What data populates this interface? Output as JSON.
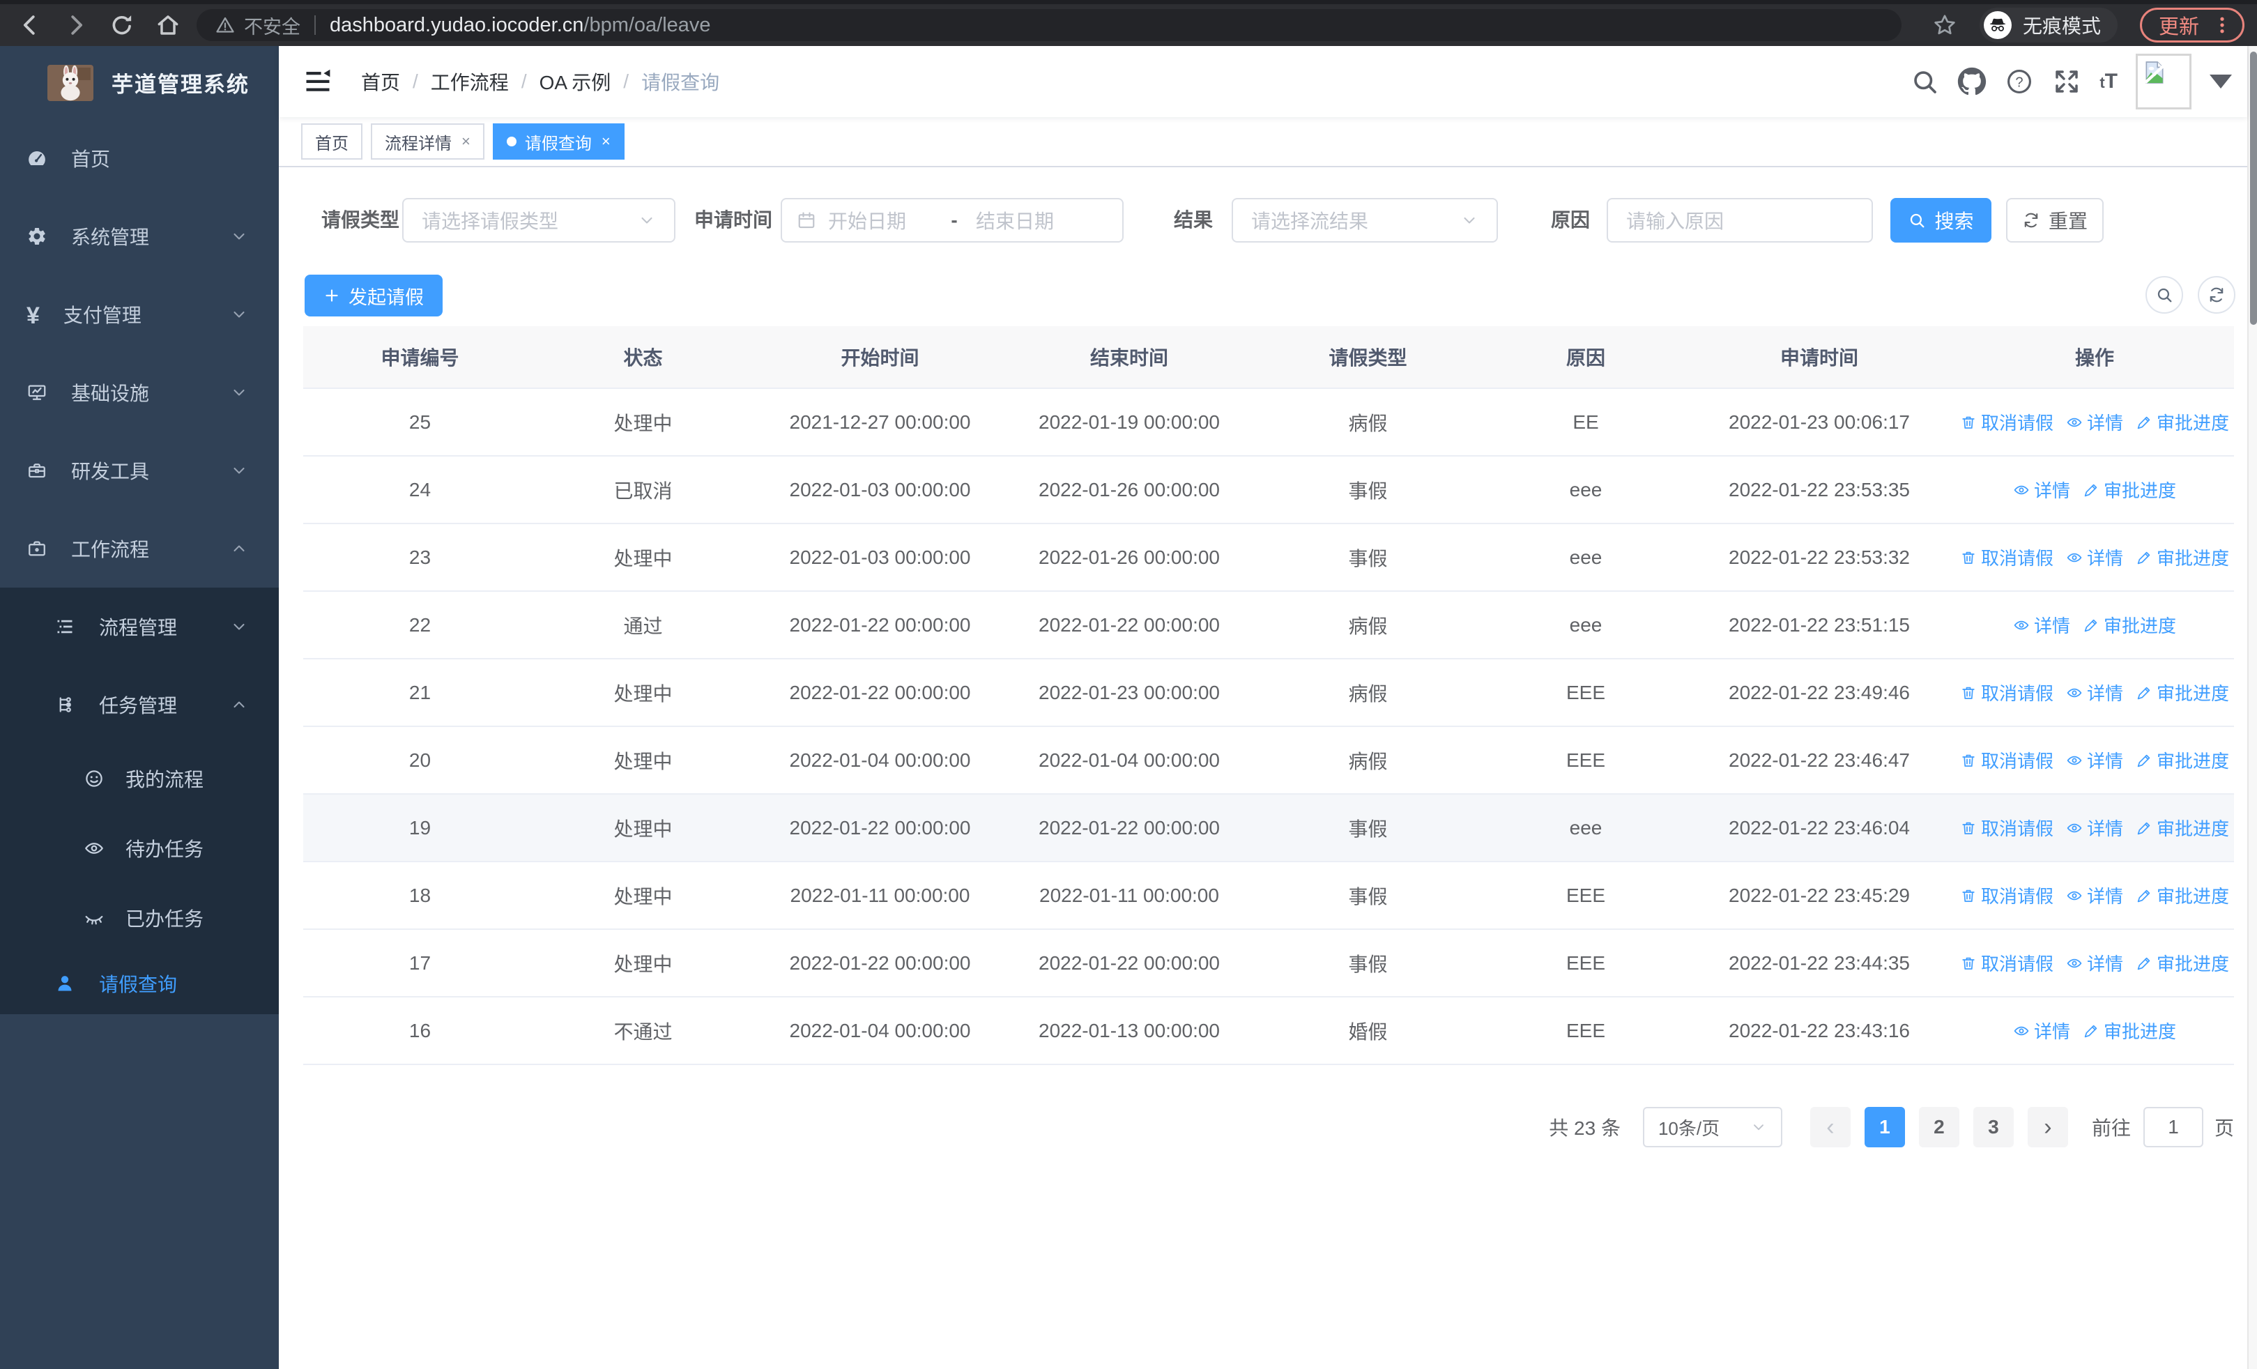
{
  "colors": {
    "accent": "#409eff",
    "sidebar_bg": "#304156",
    "submenu_bg": "#1f2d3d",
    "table_header_bg": "#f8f8f9",
    "row_hover_bg": "#f5f7fa",
    "chrome_update": "#f28b82"
  },
  "browser": {
    "security_label": "不安全",
    "url_host": "dashboard.yudao.iocoder.cn",
    "url_path": "/bpm/oa/leave",
    "incognito_label": "无痕模式",
    "update_label": "更新"
  },
  "sidebar": {
    "title": "芋道管理系统",
    "items": [
      {
        "key": "home",
        "label": "首页",
        "icon": "dashboard",
        "level": 1,
        "chevron": null,
        "sub": false,
        "active": false
      },
      {
        "key": "system",
        "label": "系统管理",
        "icon": "gear",
        "level": 1,
        "chevron": "down",
        "sub": false,
        "active": false
      },
      {
        "key": "payment",
        "label": "支付管理",
        "icon": "yen",
        "level": 1,
        "chevron": "down",
        "sub": false,
        "active": false
      },
      {
        "key": "infra",
        "label": "基础设施",
        "icon": "monitor",
        "level": 1,
        "chevron": "down",
        "sub": false,
        "active": false
      },
      {
        "key": "devtools",
        "label": "研发工具",
        "icon": "toolbox",
        "level": 1,
        "chevron": "down",
        "sub": false,
        "active": false
      },
      {
        "key": "workflow",
        "label": "工作流程",
        "icon": "briefcase",
        "level": 1,
        "chevron": "up",
        "sub": false,
        "active": false
      },
      {
        "key": "process-mgmt",
        "label": "流程管理",
        "icon": "list",
        "level": 2,
        "chevron": "down",
        "sub": true,
        "active": false
      },
      {
        "key": "task-mgmt",
        "label": "任务管理",
        "icon": "org",
        "level": 2,
        "chevron": "up",
        "sub": true,
        "active": false
      },
      {
        "key": "my-process",
        "label": "我的流程",
        "icon": "face",
        "level": 3,
        "chevron": null,
        "sub": true,
        "active": false
      },
      {
        "key": "todo-tasks",
        "label": "待办任务",
        "icon": "eye",
        "level": 3,
        "chevron": null,
        "sub": true,
        "active": false
      },
      {
        "key": "done-tasks",
        "label": "已办任务",
        "icon": "eye-off",
        "level": 3,
        "chevron": null,
        "sub": true,
        "active": false
      },
      {
        "key": "leave-query",
        "label": "请假查询",
        "icon": "person",
        "level": 2,
        "chevron": null,
        "sub": true,
        "active": true
      }
    ]
  },
  "breadcrumb": {
    "items": [
      "首页",
      "工作流程",
      "OA 示例",
      "请假查询"
    ]
  },
  "tabs": [
    {
      "key": "home",
      "label": "首页",
      "closable": false,
      "active": false
    },
    {
      "key": "process-detail",
      "label": "流程详情",
      "closable": true,
      "active": false
    },
    {
      "key": "leave-query",
      "label": "请假查询",
      "closable": true,
      "active": true
    }
  ],
  "filters": {
    "type_label": "请假类型",
    "type_placeholder": "请选择请假类型",
    "time_label": "申请时间",
    "start_placeholder": "开始日期",
    "range_separator": "-",
    "end_placeholder": "结束日期",
    "result_label": "结果",
    "result_placeholder": "请选择流结果",
    "reason_label": "原因",
    "reason_placeholder": "请输入原因",
    "search_label": "搜索",
    "reset_label": "重置"
  },
  "toolbar": {
    "create_label": "发起请假"
  },
  "table": {
    "columns": [
      "申请编号",
      "状态",
      "开始时间",
      "结束时间",
      "请假类型",
      "原因",
      "申请时间",
      "操作"
    ],
    "action_labels": {
      "cancel": "取消请假",
      "detail": "详情",
      "progress": "审批进度"
    },
    "rows": [
      {
        "id": "25",
        "status": "处理中",
        "start": "2021-12-27 00:00:00",
        "end": "2022-01-19 00:00:00",
        "type": "病假",
        "reason": "EE",
        "applied": "2022-01-23 00:06:17",
        "actions": [
          "cancel",
          "detail",
          "progress"
        ],
        "hover": false
      },
      {
        "id": "24",
        "status": "已取消",
        "start": "2022-01-03 00:00:00",
        "end": "2022-01-26 00:00:00",
        "type": "事假",
        "reason": "eee",
        "applied": "2022-01-22 23:53:35",
        "actions": [
          "detail",
          "progress"
        ],
        "hover": false
      },
      {
        "id": "23",
        "status": "处理中",
        "start": "2022-01-03 00:00:00",
        "end": "2022-01-26 00:00:00",
        "type": "事假",
        "reason": "eee",
        "applied": "2022-01-22 23:53:32",
        "actions": [
          "cancel",
          "detail",
          "progress"
        ],
        "hover": false
      },
      {
        "id": "22",
        "status": "通过",
        "start": "2022-01-22 00:00:00",
        "end": "2022-01-22 00:00:00",
        "type": "病假",
        "reason": "eee",
        "applied": "2022-01-22 23:51:15",
        "actions": [
          "detail",
          "progress"
        ],
        "hover": false
      },
      {
        "id": "21",
        "status": "处理中",
        "start": "2022-01-22 00:00:00",
        "end": "2022-01-23 00:00:00",
        "type": "病假",
        "reason": "EEE",
        "applied": "2022-01-22 23:49:46",
        "actions": [
          "cancel",
          "detail",
          "progress"
        ],
        "hover": false
      },
      {
        "id": "20",
        "status": "处理中",
        "start": "2022-01-04 00:00:00",
        "end": "2022-01-04 00:00:00",
        "type": "病假",
        "reason": "EEE",
        "applied": "2022-01-22 23:46:47",
        "actions": [
          "cancel",
          "detail",
          "progress"
        ],
        "hover": false
      },
      {
        "id": "19",
        "status": "处理中",
        "start": "2022-01-22 00:00:00",
        "end": "2022-01-22 00:00:00",
        "type": "事假",
        "reason": "eee",
        "applied": "2022-01-22 23:46:04",
        "actions": [
          "cancel",
          "detail",
          "progress"
        ],
        "hover": true
      },
      {
        "id": "18",
        "status": "处理中",
        "start": "2022-01-11 00:00:00",
        "end": "2022-01-11 00:00:00",
        "type": "事假",
        "reason": "EEE",
        "applied": "2022-01-22 23:45:29",
        "actions": [
          "cancel",
          "detail",
          "progress"
        ],
        "hover": false
      },
      {
        "id": "17",
        "status": "处理中",
        "start": "2022-01-22 00:00:00",
        "end": "2022-01-22 00:00:00",
        "type": "事假",
        "reason": "EEE",
        "applied": "2022-01-22 23:44:35",
        "actions": [
          "cancel",
          "detail",
          "progress"
        ],
        "hover": false
      },
      {
        "id": "16",
        "status": "不通过",
        "start": "2022-01-04 00:00:00",
        "end": "2022-01-13 00:00:00",
        "type": "婚假",
        "reason": "EEE",
        "applied": "2022-01-22 23:43:16",
        "actions": [
          "detail",
          "progress"
        ],
        "hover": false
      }
    ]
  },
  "pagination": {
    "total_text": "共 23 条",
    "page_size": "10条/页",
    "pages": [
      {
        "label": "1",
        "active": true
      },
      {
        "label": "2",
        "active": false
      },
      {
        "label": "3",
        "active": false
      }
    ],
    "goto_label": "前往",
    "goto_value": "1",
    "page_unit": "页"
  }
}
